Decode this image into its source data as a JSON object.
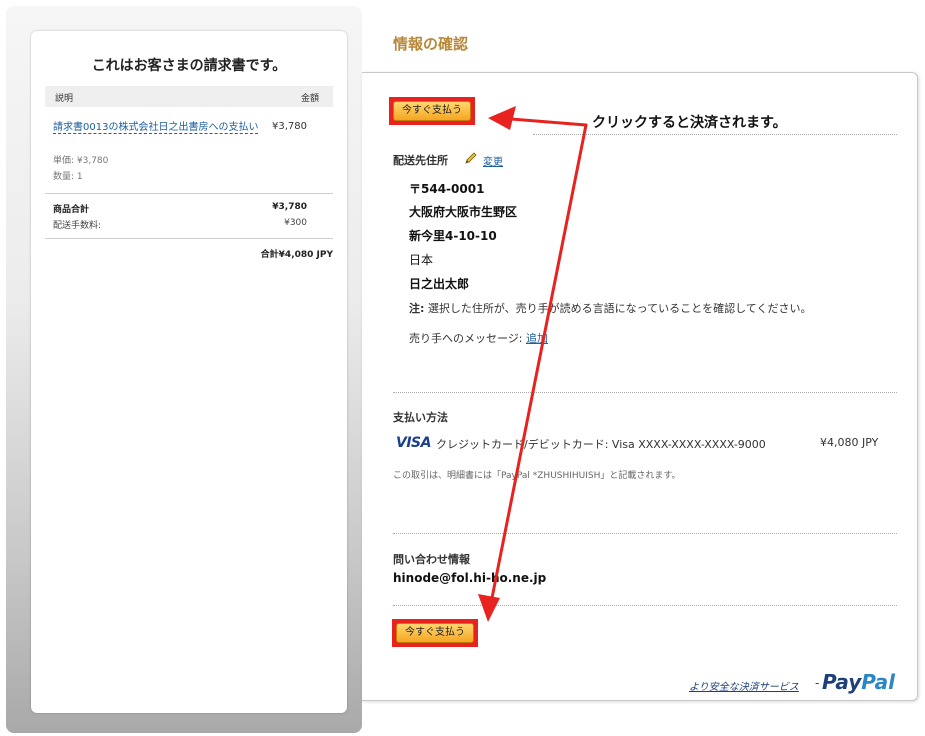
{
  "invoice": {
    "title": "これはお客さまの請求書です。",
    "col_description": "説明",
    "col_amount": "金額",
    "item": {
      "name": "請求書0013の株式会社日之出書房への支払い",
      "price": "¥3,780",
      "unit_price": "単価: ¥3,780",
      "quantity": "数量: 1"
    },
    "subtotal_label": "商品合計",
    "subtotal_value": "¥3,780",
    "shipping_label": "配送手数料:",
    "shipping_value": "¥300",
    "total": "合計¥4,080 JPY"
  },
  "page": {
    "title": "情報の確認",
    "pay_button_label": "今すぐ支払う",
    "callout": "クリックすると決済されます。"
  },
  "shipping": {
    "heading": "配送先住所",
    "edit_label": "変更",
    "postal": "〒544-0001",
    "line1": "大阪府大阪市生野区",
    "line2": "新今里4-10-10",
    "country": "日本",
    "name": "日之出太郎",
    "note_prefix": "注:",
    "note_text": "選択した住所が、売り手が読める言語になっていることを確認してください。",
    "message_label": "売り手へのメッセージ:",
    "message_link": "追加"
  },
  "payment": {
    "heading": "支払い方法",
    "card_brand": "VISA",
    "card_desc": "クレジットカード/デビットカード: Visa XXXX-XXXX-XXXX-9000",
    "amount": "¥4,080 JPY",
    "statement_note": "この取引は、明細書には「PayPal *ZHUSHIHUISH」と記載されます。"
  },
  "contact": {
    "heading": "問い合わせ情報",
    "email": "hinode@fol.hi-ho.ne.jp"
  },
  "footer": {
    "safer_text": "より安全な決済サービス",
    "dash": "-",
    "paypal_pay": "Pay",
    "paypal_pal": "Pal"
  },
  "colors": {
    "accent_title": "#b8893a",
    "link": "#1d5fa0",
    "highlight_red": "#e8221f",
    "button_orange": "#f5a623"
  }
}
